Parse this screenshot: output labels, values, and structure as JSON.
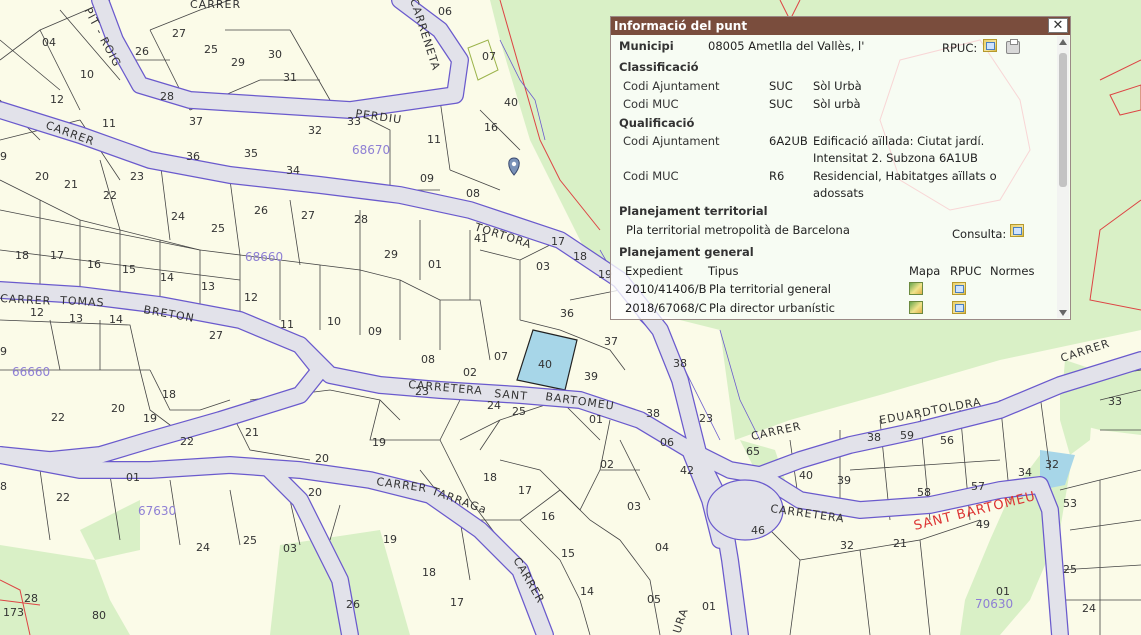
{
  "map": {
    "zone_codes": [
      "68670",
      "68660",
      "66660",
      "67630",
      "70630"
    ],
    "streets": [
      {
        "id": "carrer-n",
        "text": "CARRER"
      },
      {
        "id": "pit-roig",
        "text": "PIT - ROIG"
      },
      {
        "id": "carreneta",
        "text": "CARRENETA"
      },
      {
        "id": "perdiu",
        "text": "PERDIU"
      },
      {
        "id": "carrer-w",
        "text": "CARRER"
      },
      {
        "id": "tortora",
        "text": "TORTORA"
      },
      {
        "id": "carrer-tomas",
        "text": "CARRER"
      },
      {
        "id": "tomas",
        "text": "TOMAS"
      },
      {
        "id": "breton",
        "text": "BRETON"
      },
      {
        "id": "carretera1",
        "text": "CARRETERA"
      },
      {
        "id": "sant1",
        "text": "SANT"
      },
      {
        "id": "bartomeu1",
        "text": "BARTOMEU"
      },
      {
        "id": "carrer-tarraga",
        "text": "CARRER"
      },
      {
        "id": "tarraga",
        "text": "TARRAGa"
      },
      {
        "id": "carrer-sw",
        "text": "CARRER"
      },
      {
        "id": "carrer-eduard",
        "text": "CARRER"
      },
      {
        "id": "eduard",
        "text": "EDUARD"
      },
      {
        "id": "toldra",
        "text": "TOLDRA"
      },
      {
        "id": "carrer-ne",
        "text": "CARRER"
      },
      {
        "id": "carretera2",
        "text": "CARRETERA"
      },
      {
        "id": "ura",
        "text": "URA"
      }
    ],
    "red_label": "SANT BARTOMEU",
    "plots": [
      "06",
      "04",
      "27",
      "25",
      "29",
      "30",
      "31",
      "10",
      "26",
      "07",
      "12",
      "28",
      "40",
      "11",
      "37",
      "33",
      "32",
      "16",
      "36",
      "35",
      "34",
      "11",
      "09",
      "20",
      "21",
      "22",
      "23",
      "24",
      "25",
      "26",
      "27",
      "28",
      "08",
      "9",
      "18",
      "17",
      "16",
      "15",
      "14",
      "13",
      "12",
      "11",
      "10",
      "29",
      "01",
      "41",
      "17",
      "03",
      "18",
      "19",
      "36",
      "37",
      "40",
      "39",
      "38",
      "38",
      "23",
      "12",
      "13",
      "14",
      "27",
      "09",
      "08",
      "02",
      "07",
      "24",
      "25",
      "01",
      "22",
      "20",
      "18",
      "19",
      "21",
      "22",
      "23",
      "19",
      "20",
      "18",
      "17",
      "16",
      "02",
      "03",
      "06",
      "42",
      "15",
      "14",
      "04",
      "05",
      "22",
      "01",
      "20",
      "24",
      "25",
      "03",
      "19",
      "18",
      "17",
      "80",
      "173",
      "28",
      "26",
      "65",
      "40",
      "39",
      "46",
      "32",
      "21",
      "38",
      "59",
      "56",
      "58",
      "57",
      "34",
      "32",
      "33",
      "53",
      "49",
      "01",
      "24",
      "25",
      "01",
      "9",
      "8"
    ]
  },
  "panel": {
    "title": "Informació del punt",
    "close": "✕",
    "municipi_label": "Municipi",
    "municipi_value": "08005 Ametlla del Vallès, l'",
    "rpuc_label": "RPUC:",
    "classificacio": {
      "heading": "Classificació",
      "rows": [
        {
          "label": "Codi Ajuntament",
          "code": "SUC",
          "desc": "Sòl Urbà"
        },
        {
          "label": "Codi MUC",
          "code": "SUC",
          "desc": "Sòl urbà"
        }
      ]
    },
    "qualificacio": {
      "heading": "Qualificació",
      "rows": [
        {
          "label": "Codi Ajuntament",
          "code": "6A2UB",
          "desc1": "Edificació aïllada: Ciutat jardí.",
          "desc2": "Intensitat 2. Subzona 6A1UB"
        },
        {
          "label": "Codi MUC",
          "code": "R6",
          "desc1": "Residencial, Habitatges aïllats o",
          "desc2": "adossats"
        }
      ]
    },
    "territorial": {
      "heading": "Planejament territorial",
      "plan": "Pla territorial metropolità de Barcelona",
      "consulta": "Consulta:"
    },
    "general": {
      "heading": "Planejament general",
      "col_expedient": "Expedient",
      "col_tipus": "Tipus",
      "col_mapa": "Mapa",
      "col_rpuc": "RPUC",
      "col_normes": "Normes",
      "rows": [
        {
          "expedient": "2010/41406/B",
          "tipus": "Pla territorial general"
        },
        {
          "expedient": "2018/67068/C",
          "tipus": "Pla director urbanístic"
        }
      ]
    }
  }
}
